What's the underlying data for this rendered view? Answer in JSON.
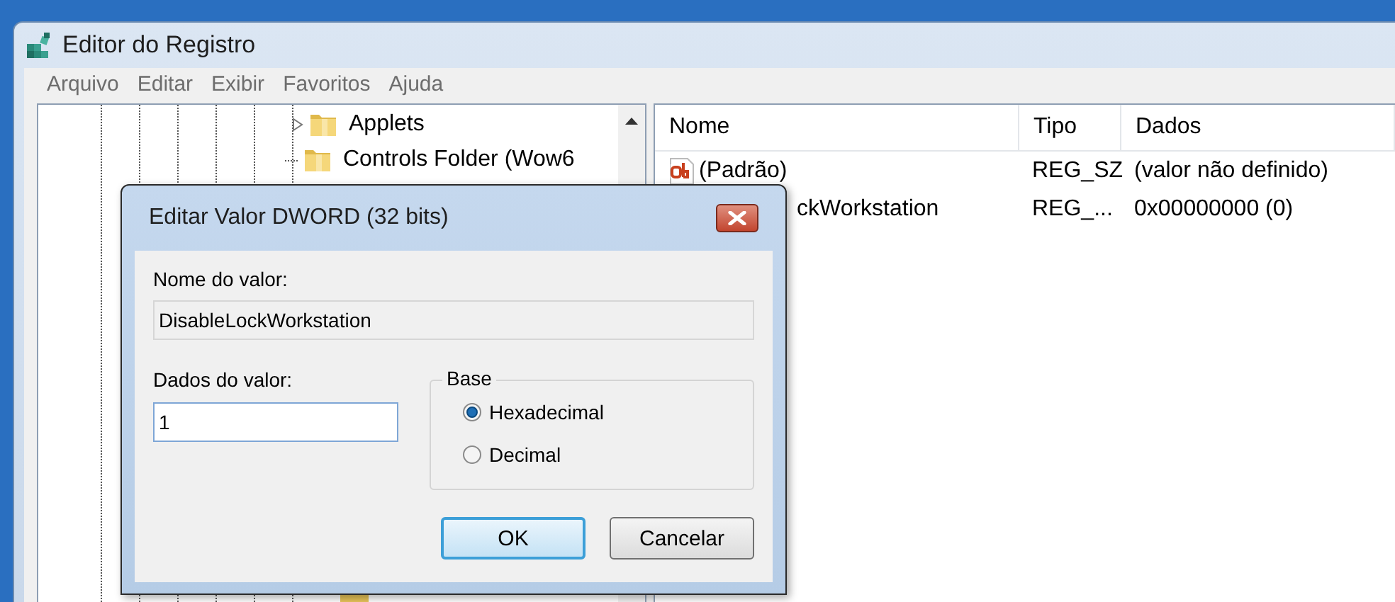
{
  "window": {
    "title": "Editor do Registro"
  },
  "menu": [
    "Arquivo",
    "Editar",
    "Exibir",
    "Favoritos",
    "Ajuda"
  ],
  "tree": {
    "items": [
      {
        "label": "Applets",
        "expandable": true
      },
      {
        "label": "Controls Folder (Wow6",
        "expandable": false
      }
    ]
  },
  "list": {
    "columns": [
      "Nome",
      "Tipo",
      "Dados"
    ],
    "rows": [
      {
        "kind": "string",
        "name": "(Padrão)",
        "type": "REG_SZ",
        "data": "(valor não definido)"
      },
      {
        "kind": "dword",
        "name": "ckWorkstation",
        "type": "REG_...",
        "data": "0x00000000 (0)"
      }
    ]
  },
  "dialog": {
    "title": "Editar Valor DWORD (32 bits)",
    "name_label": "Nome do valor:",
    "name_value": "DisableLockWorkstation",
    "data_label": "Dados do valor:",
    "data_value": "1",
    "base": {
      "label": "Base",
      "options": [
        {
          "label": "Hexadecimal",
          "selected": true
        },
        {
          "label": "Decimal",
          "selected": false
        }
      ]
    },
    "buttons": [
      {
        "label": "OK",
        "default": true
      },
      {
        "label": "Cancelar",
        "default": false
      }
    ]
  }
}
